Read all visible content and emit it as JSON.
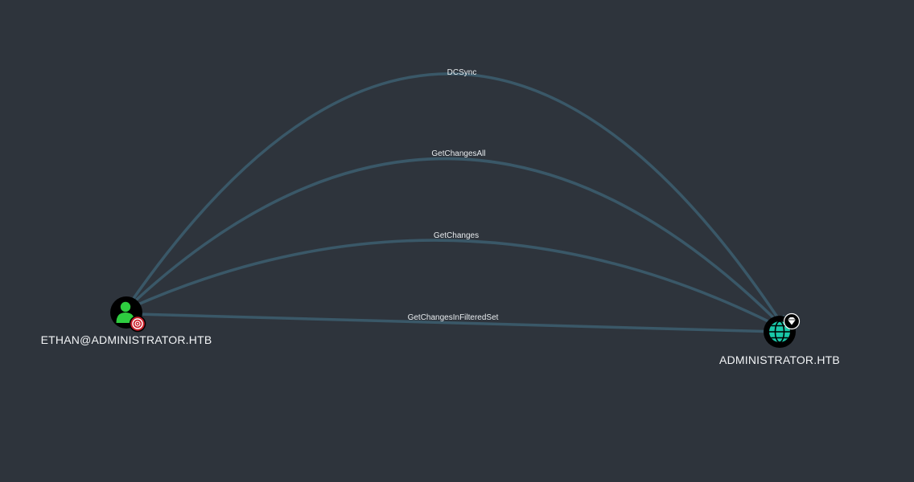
{
  "graph": {
    "nodes": {
      "source": {
        "label": "ETHAN@ADMINISTRATOR.HTB",
        "type": "User",
        "icon": "user-icon",
        "badge": "target-icon",
        "colors": {
          "disk": "#000000",
          "icon": "#2ecc40",
          "badge": "#cc1f2a"
        }
      },
      "target": {
        "label": "ADMINISTRATOR.HTB",
        "type": "Domain",
        "icon": "globe-icon",
        "badge": "diamond-icon",
        "colors": {
          "disk": "#000000",
          "icon": "#19c8a8",
          "badge": "#ffffff"
        }
      }
    },
    "edges": [
      {
        "label": "DCSync"
      },
      {
        "label": "GetChangesAll"
      },
      {
        "label": "GetChanges"
      },
      {
        "label": "GetChangesInFilteredSet"
      }
    ],
    "colors": {
      "background": "#2e343c",
      "edge": "#3a5868",
      "text": "#e8ecef"
    }
  }
}
